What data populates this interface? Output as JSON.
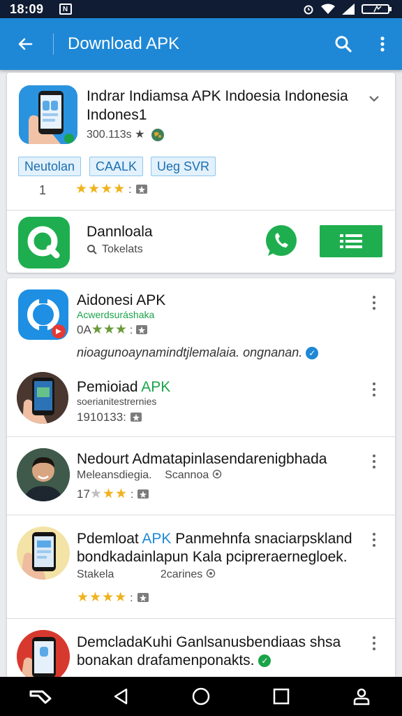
{
  "status_bar": {
    "time": "18:09",
    "n_badge": "N"
  },
  "app_bar": {
    "title": "Download APK"
  },
  "featured": {
    "title": "Indrar Indiamsa APK Indoesia Indonesia Indones1",
    "meta": "300.113s ★",
    "tags": [
      "Neutolan",
      "CAALK",
      "Ueg SVR"
    ],
    "rank": "1",
    "rating": 4,
    "separator": ":"
  },
  "download_row": {
    "title": "Dannloala",
    "subtitle": "Tokelats"
  },
  "list": [
    {
      "title": "Aidonesi APK",
      "subtitle": "Acwerdsuráshaka",
      "meta_prefix": "0A",
      "rating": 3,
      "separator": ":"
    },
    {
      "description": "nioagunoaynamindtjlemalaia. ongnanan."
    },
    {
      "title_a": "Pemioiad",
      "title_b": "APK",
      "subtitle": "soerianitestrernies",
      "meta": "1910133:",
      "rating": 0
    },
    {
      "title": "Nedourt Admatapinlasendarenigbhada",
      "subtitle": "Meleansdiegia.",
      "subtitle_b": "Scannoa",
      "meta_prefix": "17",
      "rating": 3,
      "separator": ":"
    },
    {
      "title_a": "Pdemloat",
      "title_b": "APK",
      "title_c": "Panmehnfa snaciarpskland",
      "line2": "bondkadainlapun Kala pcipreraernegloek.",
      "subtitle": "Stakela",
      "subtitle_b": "2carines",
      "rating": 4,
      "separator": ":"
    },
    {
      "title": "DemcladaKuhi Ganlsanusbendiaas shsa",
      "line2": "bonakan drafamenponakts."
    }
  ],
  "colors": {
    "app_bar": "#1e88d6",
    "status_bar": "#0f1c33",
    "star": "#f0b21d",
    "green": "#1aa34a"
  }
}
